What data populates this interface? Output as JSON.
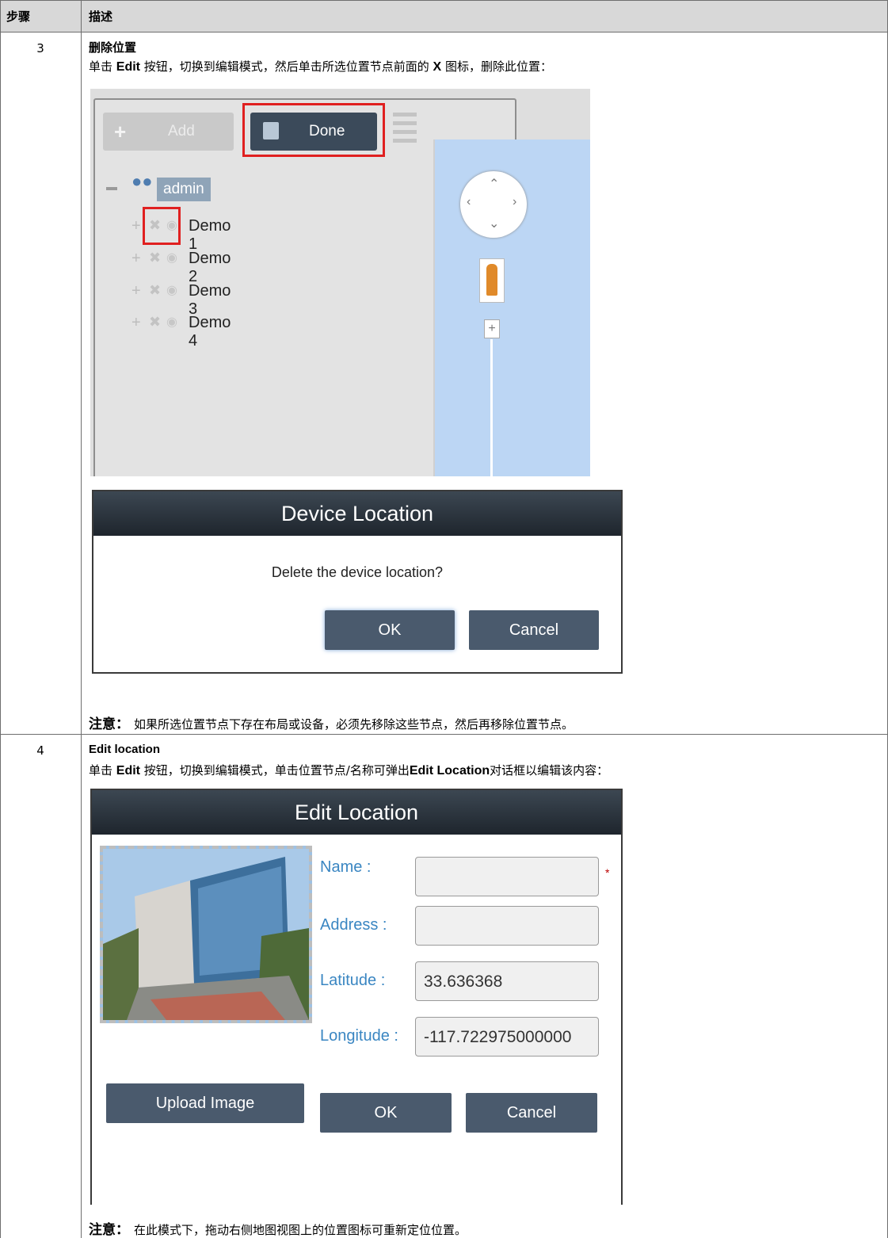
{
  "table": {
    "col_step": "步骤",
    "col_desc": "描述"
  },
  "step3": {
    "number": "3",
    "title": "删除位置",
    "desc_pre": "单击 ",
    "desc_edit": "Edit",
    "desc_mid": " 按钮，切换到编辑模式，然后单击所选位置节点前面的 ",
    "desc_x": "X",
    "desc_post": " 图标，删除此位置：",
    "note_label": "注意：",
    "note_text": "如果所选位置节点下存在布局或设备，必须先移除这些节点，然后再移除位置节点。",
    "screenshot": {
      "add_label": "Add",
      "done_label": "Done",
      "root": "admin",
      "items": [
        "Demo 1",
        "Demo 2",
        "Demo 3",
        "Demo 4"
      ],
      "zoom_plus": "+"
    },
    "dialog": {
      "title": "Device Location",
      "message": "Delete the device location?",
      "ok": "OK",
      "cancel": "Cancel"
    }
  },
  "step4": {
    "number": "4",
    "title": "Edit location",
    "desc_pre": "单击 ",
    "desc_edit": "Edit",
    "desc_mid": " 按钮，切换到编辑模式，单击位置节点/名称可弹出",
    "desc_dialog": "Edit Location",
    "desc_post": "对话框以编辑该内容：",
    "note_label": "注意：",
    "note_text": "在此模式下，拖动右侧地图视图上的位置图标可重新定位位置。",
    "dialog": {
      "title": "Edit Location",
      "name_label": "Name :",
      "name_value": "",
      "required_mark": "*",
      "address_label": "Address :",
      "address_value": "",
      "latitude_label": "Latitude :",
      "latitude_value": "33.636368",
      "longitude_label": "Longitude :",
      "longitude_value": "-117.722975000000",
      "upload": "Upload Image",
      "ok": "OK",
      "cancel": "Cancel"
    }
  },
  "colors": {
    "header_bg": "#d8d8d8",
    "highlight_red": "#e02020",
    "button_dark": "#4a5a6d",
    "label_blue": "#3a86c2"
  }
}
